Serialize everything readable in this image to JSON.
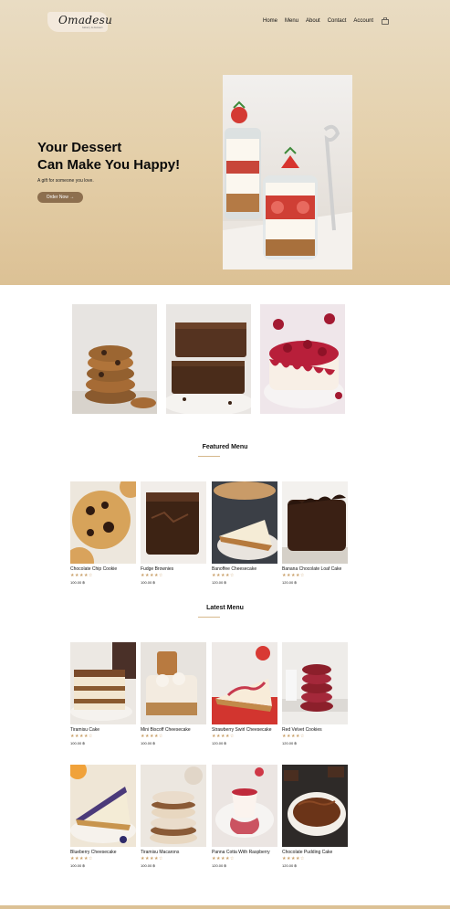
{
  "brand": {
    "name": "Omadesu",
    "tagline": "bakery & dessert"
  },
  "nav": {
    "items": [
      "Home",
      "Menu",
      "About",
      "Contact",
      "Account"
    ],
    "cart_icon": "shopping-bag-icon"
  },
  "hero": {
    "title_line1": "Your Dessert",
    "title_line2": "Can Make You Happy!",
    "subtitle": "A gift for someone you love.",
    "cta_label": "Order Now",
    "cta_arrow": "→",
    "image": "strawberry cheesecake jars"
  },
  "categories": [
    "cookies",
    "brownies",
    "cakes"
  ],
  "featured": {
    "title": "Featured Menu",
    "items": [
      {
        "name": "Chocolate Chip Cookie",
        "stars": "★★★★☆",
        "price": "100.00 ฿"
      },
      {
        "name": "Fudge Brownies",
        "stars": "★★★★☆",
        "price": "100.00 ฿"
      },
      {
        "name": "Banoffee Cheesecake",
        "stars": "★★★★☆",
        "price": "120.00 ฿"
      },
      {
        "name": "Banana Chocolate Loaf Cake",
        "stars": "★★★★☆",
        "price": "120.00 ฿"
      }
    ]
  },
  "latest": {
    "title": "Latest Menu",
    "items": [
      {
        "name": "Tiramisu Cake",
        "stars": "★★★★☆",
        "price": "100.00 ฿"
      },
      {
        "name": "Mini Biscoff Cheesecake",
        "stars": "★★★★☆",
        "price": "100.00 ฿"
      },
      {
        "name": "Strawberry Swirl Cheesecake",
        "stars": "★★★★☆",
        "price": "120.00 ฿"
      },
      {
        "name": "Red Velvet Cookies",
        "stars": "★★★★☆",
        "price": "120.00 ฿"
      },
      {
        "name": "Blueberry Cheesecake",
        "stars": "★★★★☆",
        "price": "100.00 ฿"
      },
      {
        "name": "Tiramisu Macarons",
        "stars": "★★★★☆",
        "price": "100.00 ฿"
      },
      {
        "name": "Panna Cotta With Raspberry",
        "stars": "★★★★☆",
        "price": "120.00 ฿"
      },
      {
        "name": "Chocolate Pudding Cake",
        "stars": "★★★★☆",
        "price": "120.00 ฿"
      }
    ]
  },
  "colors": {
    "accent": "#8d6f4f",
    "hero_bg": "#e4cfa9",
    "star": "#c9a06a"
  }
}
